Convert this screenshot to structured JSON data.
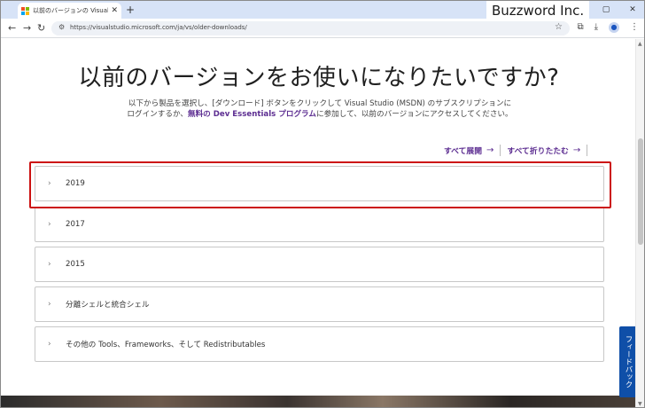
{
  "browser": {
    "tab_title": "以前のバージョンの Visual Studio",
    "tab_close": "✕",
    "new_tab": "+",
    "url": "https://visualstudio.microsoft.com/ja/vs/older-downloads/",
    "window_controls": [
      "—",
      "▢",
      "✕"
    ],
    "brand_watermark": "Buzzword Inc."
  },
  "page": {
    "headline": "以前のバージョンをお使いになりたいですか?",
    "intro_part1": "以下から製品を選択し、[ダウンロード] ボタンをクリックして Visual Studio (MSDN) のサブスクリプションにログインするか、",
    "intro_link": "無料の Dev Essentials プログラム",
    "intro_part2": "に参加して、以前のバージョンにアクセスしてください。",
    "expand_all": "すべて展開",
    "collapse_all": "すべて折りたたむ",
    "feedback_label": "フィードバック"
  },
  "accordion": [
    {
      "label": "2019"
    },
    {
      "label": "2017"
    },
    {
      "label": "2015"
    },
    {
      "label": "分離シェルと統合シェル"
    },
    {
      "label": "その他の Tools、Frameworks、そして Redistributables"
    }
  ],
  "colors": {
    "accent_purple": "#5c2d91",
    "highlight_red": "#cc1111",
    "feedback_blue": "#0f4fa8"
  }
}
